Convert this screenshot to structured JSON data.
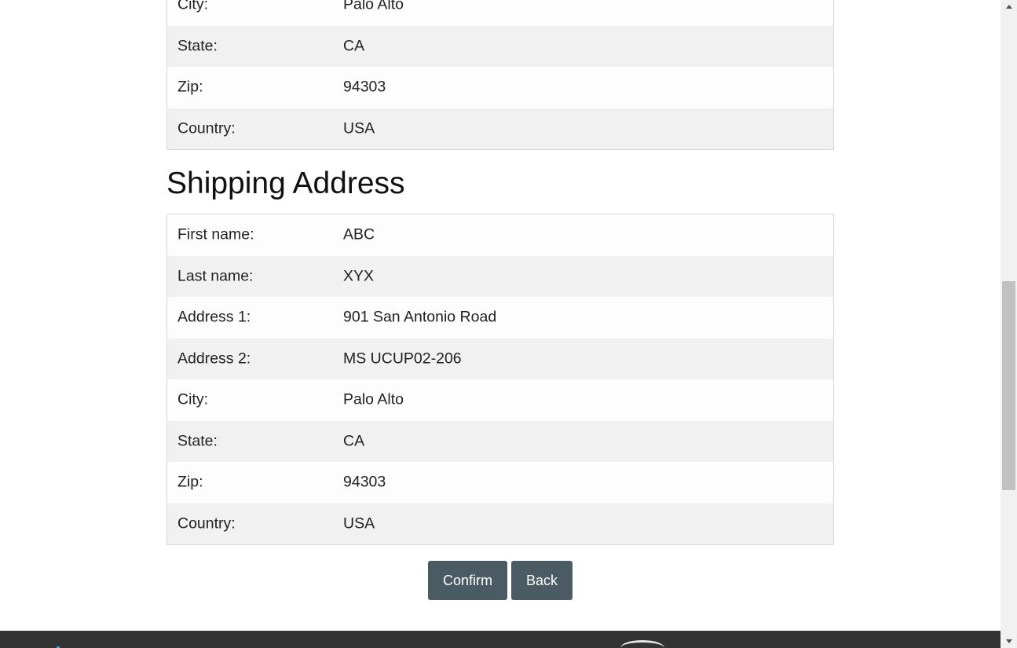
{
  "billing": {
    "rows": [
      {
        "label": "City:",
        "value": "Palo Alto"
      },
      {
        "label": "State:",
        "value": "CA"
      },
      {
        "label": "Zip:",
        "value": "94303"
      },
      {
        "label": "Country:",
        "value": "USA"
      }
    ]
  },
  "shipping": {
    "title": "Shipping Address",
    "rows": [
      {
        "label": "First name:",
        "value": "ABC"
      },
      {
        "label": "Last name:",
        "value": "XYX"
      },
      {
        "label": "Address 1:",
        "value": "901 San Antonio Road"
      },
      {
        "label": "Address 2:",
        "value": "MS UCUP02-206"
      },
      {
        "label": "City:",
        "value": "Palo Alto"
      },
      {
        "label": "State:",
        "value": "CA"
      },
      {
        "label": "Zip:",
        "value": "94303"
      },
      {
        "label": "Country:",
        "value": "USA"
      }
    ]
  },
  "actions": {
    "confirm_label": "Confirm",
    "back_label": "Back"
  },
  "colors": {
    "button_bg": "#4b5b63",
    "footer_bg": "#333333",
    "row_alt_bg": "#f1f1f1"
  }
}
